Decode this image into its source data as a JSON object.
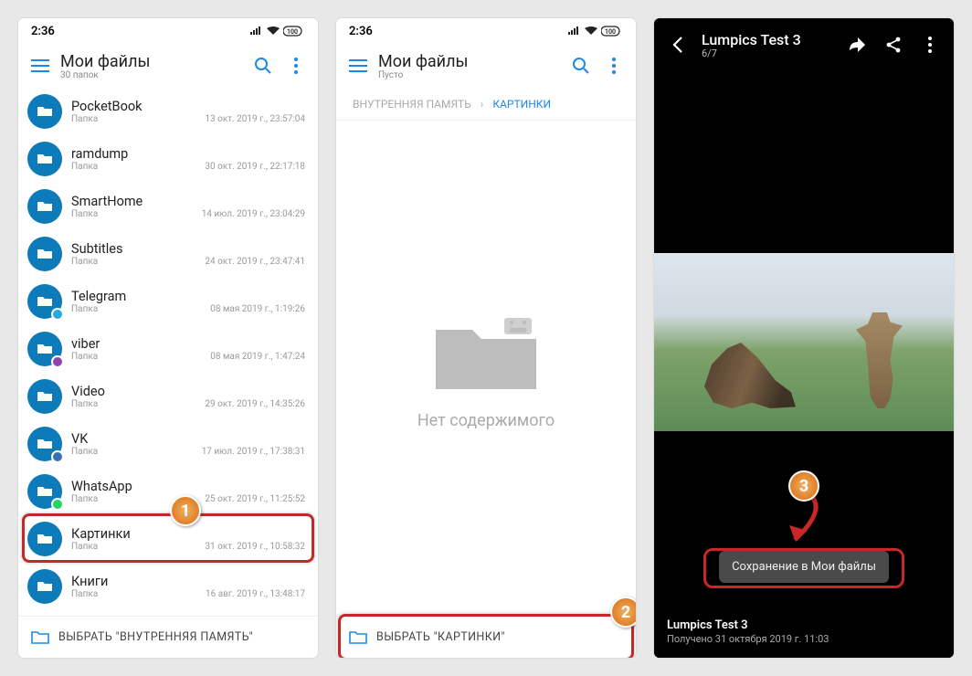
{
  "phone1": {
    "status_time": "2:36",
    "title": "Мои файлы",
    "subtitle": "30 папок",
    "folders": [
      {
        "name": "PocketBook",
        "sub": "Папка",
        "date": "13 окт. 2019 г., 23:57:04"
      },
      {
        "name": "ramdump",
        "sub": "Папка",
        "date": "30 окт. 2019 г., 22:17:18"
      },
      {
        "name": "SmartHome",
        "sub": "Папка",
        "date": "14 июл. 2019 г., 23:04:29"
      },
      {
        "name": "Subtitles",
        "sub": "Папка",
        "date": "24 окт. 2019 г., 23:47:41"
      },
      {
        "name": "Telegram",
        "sub": "Папка",
        "date": "08 мая 2019 г., 1:19:26",
        "badge": "#2aa7df"
      },
      {
        "name": "viber",
        "sub": "Папка",
        "date": "08 мая 2019 г., 1:47:24",
        "badge": "#8e44ad"
      },
      {
        "name": "Video",
        "sub": "Папка",
        "date": "29 окт. 2019 г., 14:35:26"
      },
      {
        "name": "VK",
        "sub": "Папка",
        "date": "17 июл. 2019 г., 17:38:31",
        "badge": "#3a6fb0"
      },
      {
        "name": "WhatsApp",
        "sub": "Папка",
        "date": "25 окт. 2019 г., 11:25:52",
        "badge": "#25d366"
      },
      {
        "name": "Картинки",
        "sub": "Папка",
        "date": "31 окт. 2019 г., 10:58:32",
        "highlight": true
      },
      {
        "name": "Книги",
        "sub": "Папка",
        "date": "16 авг. 2019 г., 13:48:17"
      }
    ],
    "bottom": "ВЫБРАТЬ \"ВНУТРЕННЯЯ ПАМЯТЬ\"",
    "badge": "1"
  },
  "phone2": {
    "status_time": "2:36",
    "title": "Мои файлы",
    "subtitle": "Пусто",
    "crumb1": "ВНУТРЕННЯЯ ПАМЯТЬ",
    "crumb2": "КАРТИНКИ",
    "empty_text": "Нет содержимого",
    "bottom": "ВЫБРАТЬ \"КАРТИНКИ\"",
    "badge": "2"
  },
  "phone3": {
    "title": "Lumpics Test 3",
    "subtitle": "6/7",
    "toast": "Сохранение в Мои файлы",
    "caption1": "Lumpics Test 3",
    "caption2": "Получено 31 октября 2019 г. 11:03",
    "badge": "3"
  }
}
